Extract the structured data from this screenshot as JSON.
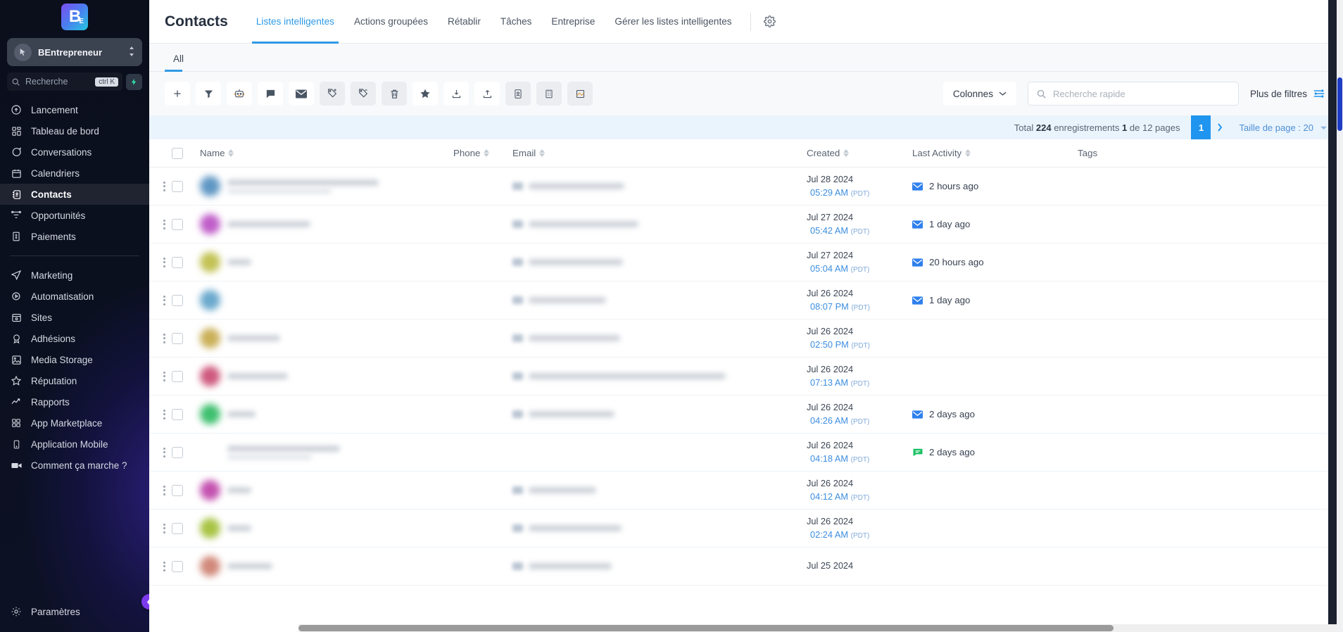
{
  "sidebar": {
    "logo": {
      "letter": "B",
      "sub": "E"
    },
    "workspace": {
      "name": "BEntrepreneur",
      "avatar_icon": "cursor-icon",
      "caret_icon": "chevron-updown-icon"
    },
    "search": {
      "placeholder": "Recherche",
      "shortcut": "ctrl K",
      "bolt_icon": "lightning-icon"
    },
    "items": [
      {
        "label": "Lancement",
        "icon": "rocket-launch-icon",
        "active": false
      },
      {
        "label": "Tableau de bord",
        "icon": "dashboard-grid-icon",
        "active": false
      },
      {
        "label": "Conversations",
        "icon": "chat-bubble-icon",
        "active": false
      },
      {
        "label": "Calendriers",
        "icon": "calendar-icon",
        "active": false
      },
      {
        "label": "Contacts",
        "icon": "contacts-book-icon",
        "active": true
      },
      {
        "label": "Opportunités",
        "icon": "funnel-opportunity-icon",
        "active": false
      },
      {
        "label": "Paiements",
        "icon": "payments-bill-icon",
        "active": false
      }
    ],
    "items2": [
      {
        "label": "Marketing",
        "icon": "paper-plane-icon"
      },
      {
        "label": "Automatisation",
        "icon": "play-circle-icon"
      },
      {
        "label": "Sites",
        "icon": "browser-window-icon"
      },
      {
        "label": "Adhésions",
        "icon": "award-badge-icon"
      },
      {
        "label": "Media Storage",
        "icon": "image-icon"
      },
      {
        "label": "Réputation",
        "icon": "star-outline-icon"
      },
      {
        "label": "Rapports",
        "icon": "trending-up-icon"
      },
      {
        "label": "App Marketplace",
        "icon": "grid-apps-icon"
      },
      {
        "label": "Application Mobile",
        "icon": "mobile-phone-icon"
      },
      {
        "label": "Comment ça marche ?",
        "icon": "video-camera-icon"
      }
    ],
    "settings": {
      "label": "Paramètres",
      "icon": "gear-icon"
    },
    "collapse_icon": "chevron-left-icon"
  },
  "header": {
    "title": "Contacts",
    "tabs": [
      {
        "label": "Listes intelligentes",
        "active": true
      },
      {
        "label": "Actions groupées",
        "active": false
      },
      {
        "label": "Rétablir",
        "active": false
      },
      {
        "label": "Tâches",
        "active": false
      },
      {
        "label": "Entreprise",
        "active": false
      },
      {
        "label": "Gérer les listes intelligentes",
        "active": false
      }
    ],
    "gear_icon": "gear-icon"
  },
  "subheader": {
    "tabs": [
      {
        "label": "All",
        "active": true
      }
    ]
  },
  "toolbar": {
    "buttons": [
      {
        "name": "add-contact-button",
        "icon": "plus-icon",
        "dim": false
      },
      {
        "name": "filter-button",
        "icon": "funnel-filter-icon",
        "dim": false
      },
      {
        "name": "automation-bot-button",
        "icon": "robot-icon",
        "dim": false
      },
      {
        "name": "sms-button",
        "icon": "message-icon",
        "dim": false
      },
      {
        "name": "email-button",
        "icon": "envelope-icon",
        "dim": false
      },
      {
        "name": "add-tag-button",
        "icon": "tag-plus-icon",
        "dim": true
      },
      {
        "name": "remove-tag-button",
        "icon": "tag-minus-icon",
        "dim": true
      },
      {
        "name": "delete-button",
        "icon": "trash-icon",
        "dim": true
      },
      {
        "name": "favorite-button",
        "icon": "star-filled-icon",
        "dim": false
      },
      {
        "name": "import-button",
        "icon": "download-tray-icon",
        "dim": false
      },
      {
        "name": "export-button",
        "icon": "upload-tray-icon",
        "dim": false
      },
      {
        "name": "assign-owner-button",
        "icon": "contact-card-icon",
        "dim": true
      },
      {
        "name": "merge-company-button",
        "icon": "building-icon",
        "dim": true
      },
      {
        "name": "restore-button",
        "icon": "frame-restore-icon",
        "dim": true
      }
    ],
    "columns_label": "Colonnes",
    "columns_caret_icon": "chevron-down-icon",
    "search": {
      "placeholder": "Recherche rapide",
      "value": "",
      "icon": "search-icon"
    },
    "more_filters_label": "Plus de filtres",
    "more_filters_icon": "sliders-icon"
  },
  "pagination": {
    "total_prefix": "Total",
    "total_count": "224",
    "records_word": "enregistrements",
    "current_page": "1",
    "of_text": "de 12 pages",
    "page_button": "1",
    "next_icon": "chevron-right-icon",
    "page_size_label": "Taille de page : 20",
    "page_size_caret_icon": "chevron-down-icon"
  },
  "table": {
    "columns": [
      {
        "key": "name",
        "label": "Name",
        "sortable": true
      },
      {
        "key": "phone",
        "label": "Phone",
        "sortable": true
      },
      {
        "key": "email",
        "label": "Email",
        "sortable": true
      },
      {
        "key": "created",
        "label": "Created",
        "sortable": true
      },
      {
        "key": "activity",
        "label": "Last Activity",
        "sortable": true
      },
      {
        "key": "tags",
        "label": "Tags",
        "sortable": false
      }
    ],
    "rows": [
      {
        "avatar_color": "#5f97c4",
        "name_width": 215,
        "name_w2": 148,
        "has_email": true,
        "email_width": 136,
        "created_date": "Jul 28 2024",
        "created_time": "05:29 AM",
        "created_tz": "(PDT)",
        "activity": "2 hours ago",
        "activity_icon": "email-icon",
        "activity_color": "#2f80ed",
        "tags": ""
      },
      {
        "avatar_color": "#c05ec9",
        "name_width": 118,
        "name_w2": 0,
        "has_email": true,
        "email_width": 156,
        "created_date": "Jul 27 2024",
        "created_time": "05:42 AM",
        "created_tz": "(PDT)",
        "activity": "1 day ago",
        "activity_icon": "email-icon",
        "activity_color": "#2f80ed",
        "tags": ""
      },
      {
        "avatar_color": "#c2c254",
        "name_width": 34,
        "name_w2": 0,
        "has_email": true,
        "email_width": 134,
        "created_date": "Jul 27 2024",
        "created_time": "05:04 AM",
        "created_tz": "(PDT)",
        "activity": "20 hours ago",
        "activity_icon": "email-icon",
        "activity_color": "#2f80ed",
        "tags": ""
      },
      {
        "avatar_color": "#6aa9cd",
        "name_width": 0,
        "name_w2": 0,
        "has_email": true,
        "email_width": 110,
        "created_date": "Jul 26 2024",
        "created_time": "08:07 PM",
        "created_tz": "(PDT)",
        "activity": "1 day ago",
        "activity_icon": "email-icon",
        "activity_color": "#2f80ed",
        "tags": ""
      },
      {
        "avatar_color": "#cbb059",
        "name_width": 75,
        "name_w2": 0,
        "has_email": true,
        "email_width": 130,
        "created_date": "Jul 26 2024",
        "created_time": "02:50 PM",
        "created_tz": "(PDT)",
        "activity": "",
        "activity_icon": "",
        "activity_color": "",
        "tags": ""
      },
      {
        "avatar_color": "#cf5a7e",
        "name_width": 86,
        "name_w2": 0,
        "has_email": true,
        "email_width": 280,
        "created_date": "Jul 26 2024",
        "created_time": "07:13 AM",
        "created_tz": "(PDT)",
        "activity": "",
        "activity_icon": "",
        "activity_color": "",
        "tags": ""
      },
      {
        "avatar_color": "#3fc06f",
        "name_width": 40,
        "name_w2": 0,
        "has_email": true,
        "email_width": 122,
        "created_date": "Jul 26 2024",
        "created_time": "04:26 AM",
        "created_tz": "(PDT)",
        "activity": "2 days ago",
        "activity_icon": "email-icon",
        "activity_color": "#2f80ed",
        "tags": ""
      },
      {
        "avatar_color": "",
        "name_width": 160,
        "name_w2": 120,
        "has_email": false,
        "email_width": 0,
        "created_date": "Jul 26 2024",
        "created_time": "04:18 AM",
        "created_tz": "(PDT)",
        "activity": "2 days ago",
        "activity_icon": "sms-icon",
        "activity_color": "#16c060",
        "tags": ""
      },
      {
        "avatar_color": "#c452b0",
        "name_width": 34,
        "name_w2": 0,
        "has_email": true,
        "email_width": 96,
        "created_date": "Jul 26 2024",
        "created_time": "04:12 AM",
        "created_tz": "(PDT)",
        "activity": "",
        "activity_icon": "",
        "activity_color": "",
        "tags": ""
      },
      {
        "avatar_color": "#a8c444",
        "name_width": 34,
        "name_w2": 0,
        "has_email": true,
        "email_width": 132,
        "created_date": "Jul 26 2024",
        "created_time": "02:24 AM",
        "created_tz": "(PDT)",
        "activity": "",
        "activity_icon": "",
        "activity_color": "",
        "tags": ""
      },
      {
        "avatar_color": "#d1897a",
        "name_width": 64,
        "name_w2": 0,
        "has_email": true,
        "email_width": 118,
        "created_date": "Jul 25 2024",
        "created_time": "",
        "created_tz": "",
        "activity": "",
        "activity_icon": "",
        "activity_color": "",
        "tags": ""
      }
    ]
  },
  "colors": {
    "accent": "#2f9ae5",
    "page_active": "#1f95ef",
    "sidebar_bg": "#0b0f1c",
    "strip_bg": "#eaf4fd"
  }
}
